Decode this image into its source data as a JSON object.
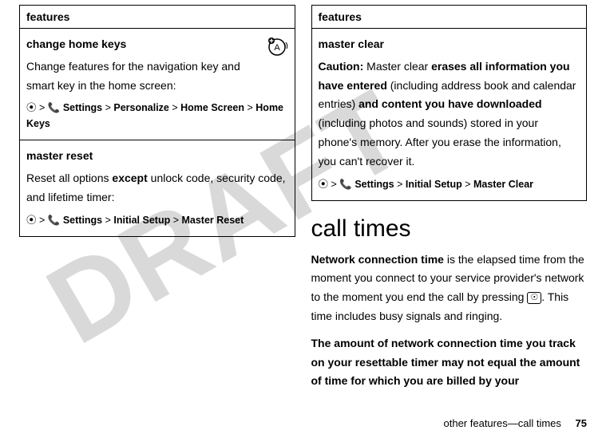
{
  "watermark": "DRAFT",
  "left": {
    "header": "features",
    "row1": {
      "title": "change home keys",
      "desc": "Change features for the navigation key and smart key in the home screen:",
      "path_prefix_glyph": "•̂",
      "path": " >  Settings > Personalize > Home Screen > Home Keys",
      "settings_icon": "📞"
    },
    "row2": {
      "title": "master reset",
      "desc_pre": "Reset all options ",
      "desc_bold": "except",
      "desc_post": " unlock code, security code, and lifetime timer:",
      "path": " >  Settings > Initial Setup > Master Reset"
    }
  },
  "right": {
    "header": "features",
    "row1": {
      "title": "master clear",
      "caution_label": "Caution:",
      "t1": " Master clear ",
      "b1": "erases all information you have entered",
      "t2": " (including address book and calendar entries) ",
      "b2": "and content you have downloaded",
      "t3": " (including photos and sounds) stored in your phone's memory. After you erase the information, you can't recover it.",
      "path": " >  Settings > Initial Setup > Master Clear"
    }
  },
  "section_heading": "call times",
  "para1_b": "Network connection time",
  "para1_rest": " is the elapsed time from the moment you connect to your service provider's network to the moment you end the call by pressing ",
  "para1_tail": ". This time includes busy signals and ringing.",
  "end_key": "☉",
  "para2": "The amount of network connection time you track on your resettable timer may not equal the amount of time for which you are billed by your",
  "footer_text": "other features—call times",
  "page_number": "75"
}
